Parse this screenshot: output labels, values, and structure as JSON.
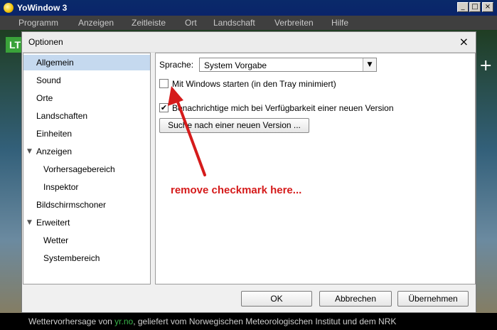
{
  "app": {
    "title": "YoWindow 3",
    "logo_icon": "sun-icon",
    "window_controls": [
      "_",
      "□",
      "×"
    ],
    "menu": [
      "Programm",
      "Anzeigen",
      "Zeitleiste",
      "Ort",
      "Landschaft",
      "Verbreiten",
      "Hilfe"
    ],
    "footer": {
      "prefix": "Wettervorhersage von ",
      "link": "yr.no",
      "suffix": ", geliefert vom Norwegischen Meteorologischen Institut und dem NRK"
    },
    "background_badge": "LT",
    "background_plus": "+"
  },
  "dialog": {
    "title": "Optionen",
    "close": "×",
    "nav": [
      {
        "label": "Allgemein",
        "selected": true
      },
      {
        "label": "Sound"
      },
      {
        "label": "Orte"
      },
      {
        "label": "Landschaften"
      },
      {
        "label": "Einheiten"
      },
      {
        "label": "Anzeigen",
        "expandable": true
      },
      {
        "label": "Vorhersagebereich",
        "child": true
      },
      {
        "label": "Inspektor",
        "child": true
      },
      {
        "label": "Bildschirmschoner"
      },
      {
        "label": "Erweitert",
        "expandable": true
      },
      {
        "label": "Wetter",
        "child": true
      },
      {
        "label": "Systembereich",
        "child": true
      }
    ],
    "general": {
      "language_label": "Sprache:",
      "language_value": "System Vorgabe",
      "start_with_windows": {
        "label": "Mit Windows starten (in den Tray minimiert)",
        "checked": false
      },
      "notify_new_version": {
        "label": "Benachrichtige mich bei Verfügbarkeit einer neuen Version",
        "checked": true
      },
      "check_version_button": "Suche nach einer neuen Version ..."
    },
    "buttons": {
      "ok": "OK",
      "cancel": "Abbrechen",
      "apply": "Übernehmen"
    }
  },
  "annotation": {
    "text": "remove checkmark here...",
    "color": "#d51b1b"
  }
}
